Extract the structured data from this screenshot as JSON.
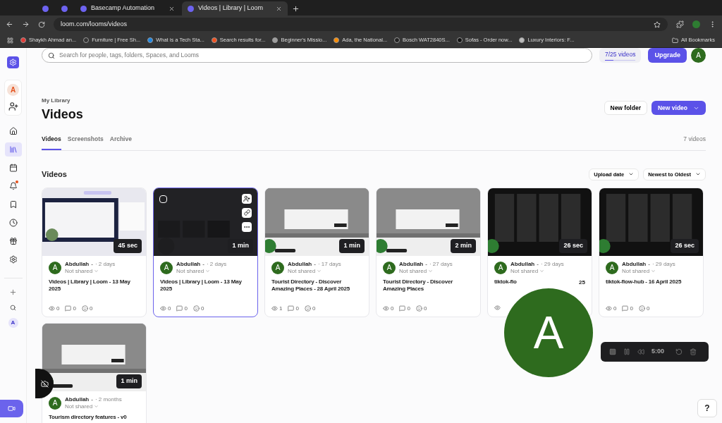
{
  "browser": {
    "tabs": [
      {
        "selected": false
      },
      {
        "selected": false
      },
      {
        "label": "Basecamp Automation",
        "selected": false
      },
      {
        "label": "Videos | Library | Loom",
        "selected": true
      }
    ],
    "address": "loom.com/looms/videos",
    "bookmarks": [
      {
        "label": "Shaykh Ahmad an...",
        "color": "#e53935"
      },
      {
        "label": "Furniture | Free Sh...",
        "color": "#333333"
      },
      {
        "label": "What is a Tech Sta...",
        "color": "#1e88e5"
      },
      {
        "label": "Search results for...",
        "color": "#f4511e"
      },
      {
        "label": "Beginner's Missio...",
        "color": "#9e9e9e"
      },
      {
        "label": "Ada, the National...",
        "color": "#fb8c00"
      },
      {
        "label": "Bosch WAT2840S...",
        "color": "#222222"
      },
      {
        "label": "Sofas - Order now...",
        "color": "#111111"
      },
      {
        "label": "Luxury Interiors: F...",
        "color": "#bdbdbd"
      }
    ],
    "all_bookmarks": "All Bookmarks"
  },
  "sidebar": {
    "workspace_initial": "A",
    "items": [
      {
        "kind": "home",
        "selected": false
      },
      {
        "kind": "library",
        "selected": true
      },
      {
        "kind": "calendar",
        "selected": false
      },
      {
        "kind": "bell",
        "selected": false,
        "badge": true
      },
      {
        "kind": "bookmark",
        "selected": false
      },
      {
        "kind": "clock",
        "selected": false
      },
      {
        "kind": "gift",
        "selected": false
      },
      {
        "kind": "settings",
        "selected": false
      }
    ],
    "user_initial": "A"
  },
  "header": {
    "search_placeholder": "Search for people, tags, folders, Spaces, and Looms",
    "quota": {
      "label": "7/25 videos",
      "level": 0.28
    },
    "upgrade": "Upgrade",
    "avatar": "A"
  },
  "page": {
    "breadcrumb": "My Library",
    "title": "Videos",
    "new_folder": "New folder",
    "new_video": "New video",
    "tabs": [
      {
        "label": "Videos",
        "selected": true
      },
      {
        "label": "Screenshots",
        "selected": false
      },
      {
        "label": "Archive",
        "selected": false
      }
    ],
    "count": "7 videos",
    "section": "Videos",
    "sort_field": "Upload date",
    "sort_order": "Newest to Oldest"
  },
  "videos": [
    {
      "duration": "45 sec",
      "avatar": "A",
      "author": "Abdullah",
      "dot": "-",
      "age": "· 2 days",
      "sharing": "Not shared",
      "title": "Videos | Library | Loom - 13 May 2025",
      "selected": false,
      "stats": [
        {
          "kind": "views",
          "value": "0"
        },
        {
          "kind": "comments",
          "value": "0"
        },
        {
          "kind": "reactions",
          "value": "0"
        }
      ]
    },
    {
      "duration": "1 min",
      "avatar": "A",
      "author": "Abdullah",
      "dot": "-",
      "age": "· 2 days",
      "sharing": "Not shared",
      "title": "Videos | Library | Loom - 13 May 2025",
      "selected": true,
      "checked": false,
      "stats": [
        {
          "kind": "views",
          "value": "0"
        },
        {
          "kind": "comments",
          "value": "0"
        },
        {
          "kind": "reactions",
          "value": "0"
        }
      ]
    },
    {
      "duration": "1 min",
      "avatar": "A",
      "author": "Abdullah",
      "dot": "-",
      "age": "· 17 days",
      "sharing": "Not shared",
      "title": "Tourist Directory - Discover Amazing Places - 28 April 2025",
      "selected": false,
      "stats": [
        {
          "kind": "views",
          "value": "1"
        },
        {
          "kind": "comments",
          "value": "0"
        },
        {
          "kind": "reactions",
          "value": "0"
        }
      ]
    },
    {
      "duration": "2 min",
      "avatar": "A",
      "author": "Abdullah",
      "dot": "-",
      "age": "· 27 days",
      "sharing": "Not shared",
      "title": "Tourist Directory - Discover Amazing Places",
      "selected": false,
      "stats": [
        {
          "kind": "views",
          "value": "0"
        },
        {
          "kind": "comments",
          "value": "0"
        },
        {
          "kind": "reactions",
          "value": "0"
        }
      ]
    },
    {
      "duration": "26 sec",
      "avatar": "A",
      "author": "Abdullah",
      "dot": "-",
      "age": "· 29 days",
      "sharing": "Not shared",
      "title": "tiktok-flo",
      "title_end": "25",
      "selected": false,
      "stats": [
        {
          "kind": "views"
        }
      ]
    },
    {
      "duration": "26 sec",
      "avatar": "A",
      "author": "Abdullah",
      "dot": "-",
      "age": "· 29 days",
      "sharing": "Not shared",
      "title": "tiktok-flow-hub - 16 April 2025",
      "selected": false,
      "stats": [
        {
          "kind": "views",
          "value": "0"
        },
        {
          "kind": "comments",
          "value": "0"
        },
        {
          "kind": "reactions",
          "value": "0"
        }
      ]
    },
    {
      "duration": "1 min",
      "avatar": "A",
      "author": "Abdullah",
      "dot": "-",
      "age": "· 2 months",
      "sharing": "Not shared",
      "title": "Tourism directory features - v0",
      "selected": false
    }
  ],
  "camera_bubble": {
    "initial": "A"
  },
  "recorder": {
    "time": "5:00"
  },
  "help": "?"
}
